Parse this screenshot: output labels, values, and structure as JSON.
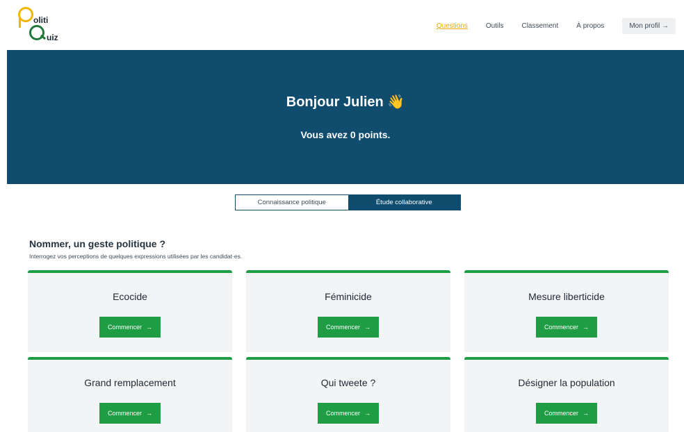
{
  "logo": {
    "line1": "oliti",
    "line2": "uiz"
  },
  "nav": {
    "items": [
      {
        "label": "Questions",
        "active": true
      },
      {
        "label": "Outils",
        "active": false
      },
      {
        "label": "Classement",
        "active": false
      },
      {
        "label": "À propos",
        "active": false
      }
    ],
    "profile_label": "Mon profil →"
  },
  "hero": {
    "title": "Bonjour Julien 👋",
    "subtitle": "Vous avez 0 points."
  },
  "toggle": {
    "options": [
      {
        "label": "Connaissance politique",
        "selected": false
      },
      {
        "label": "Étude collaborative",
        "selected": true
      }
    ]
  },
  "section": {
    "title": "Nommer, un geste politique ?",
    "subtitle": "Interrogez vos perceptions de quelques expressions utilisées par les candidat·es."
  },
  "cards": [
    {
      "title": "Ecocide",
      "button": "Commencer",
      "arrow": "→"
    },
    {
      "title": "Féminicide",
      "button": "Commencer",
      "arrow": "→"
    },
    {
      "title": "Mesure liberticide",
      "button": "Commencer",
      "arrow": "→"
    },
    {
      "title": "Grand remplacement",
      "button": "Commencer",
      "arrow": "→"
    },
    {
      "title": "Qui tweete ?",
      "button": "Commencer",
      "arrow": "→"
    },
    {
      "title": "Désigner la population",
      "button": "Commencer",
      "arrow": "→"
    }
  ],
  "colors": {
    "brand_blue": "#0f4c6e",
    "accent_green": "#1f9d45",
    "active_nav": "#e6a800"
  }
}
